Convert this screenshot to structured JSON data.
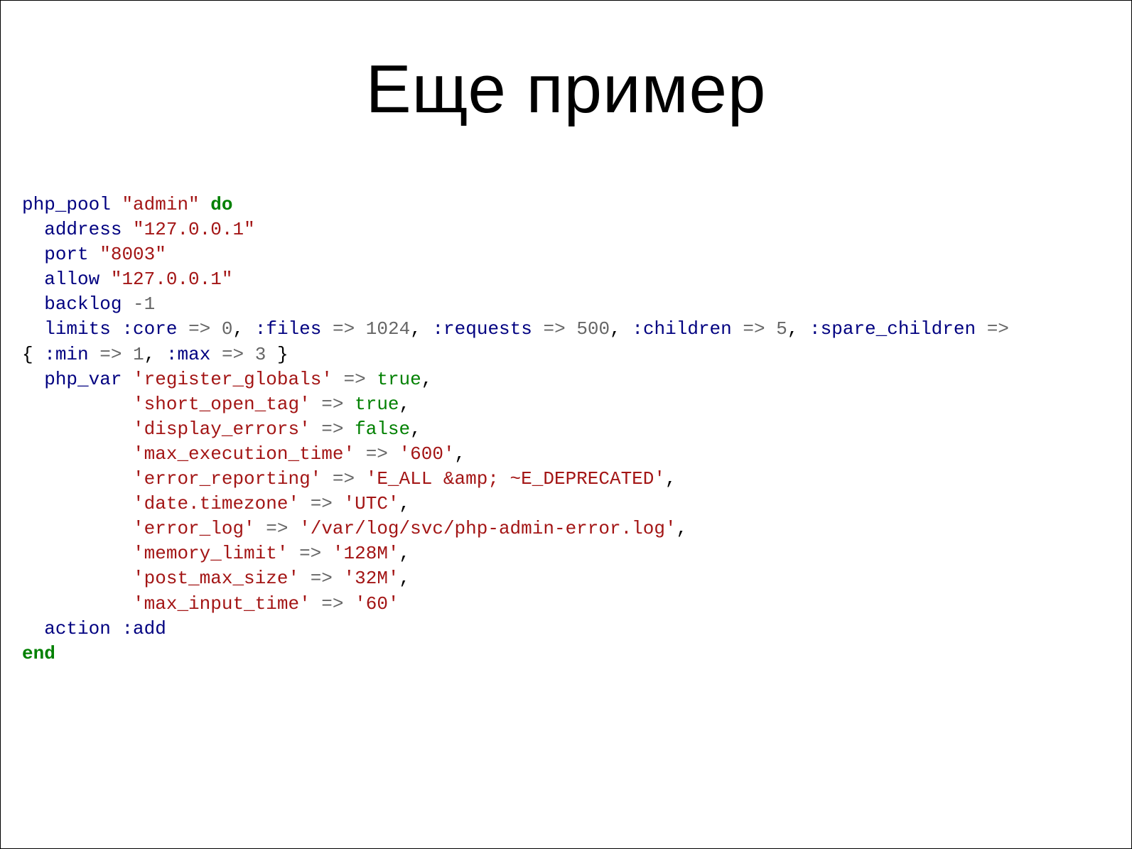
{
  "title": "Еще пример",
  "code": {
    "php_pool": "php_pool",
    "admin": "\"admin\"",
    "do": "do",
    "address": "address",
    "address_val": "\"127.0.0.1\"",
    "port": "port",
    "port_val": "\"8003\"",
    "allow": "allow",
    "allow_val": "\"127.0.0.1\"",
    "backlog": "backlog",
    "neg1": "-1",
    "limits": "limits",
    "core_sym": ":core",
    "arrow": "=>",
    "zero": "0",
    "files_sym": ":files",
    "n1024": "1024",
    "requests_sym": ":requests",
    "n500": "500",
    "children_sym": ":children",
    "n5": "5",
    "spare_sym": ":spare_children",
    "min_sym": ":min",
    "n1": "1",
    "max_sym": ":max",
    "n3": "3",
    "php_var": "php_var",
    "reg_glob": "'register_globals'",
    "true": "true",
    "short_open": "'short_open_tag'",
    "disp_err": "'display_errors'",
    "false": "false",
    "max_exec": "'max_execution_time'",
    "v600": "'600'",
    "err_rep": "'error_reporting'",
    "err_rep_val": "'E_ALL &amp; ~E_DEPRECATED'",
    "tz": "'date.timezone'",
    "utc": "'UTC'",
    "err_log": "'error_log'",
    "err_log_val": "'/var/log/svc/php-admin-error.log'",
    "mem_lim": "'memory_limit'",
    "v128m": "'128M'",
    "post_max": "'post_max_size'",
    "v32m": "'32M'",
    "max_inp": "'max_input_time'",
    "v60": "'60'",
    "action": "action",
    "add_sym": ":add",
    "end": "end",
    "comma": ",",
    "lbrace": "{",
    "rbrace": "}"
  }
}
